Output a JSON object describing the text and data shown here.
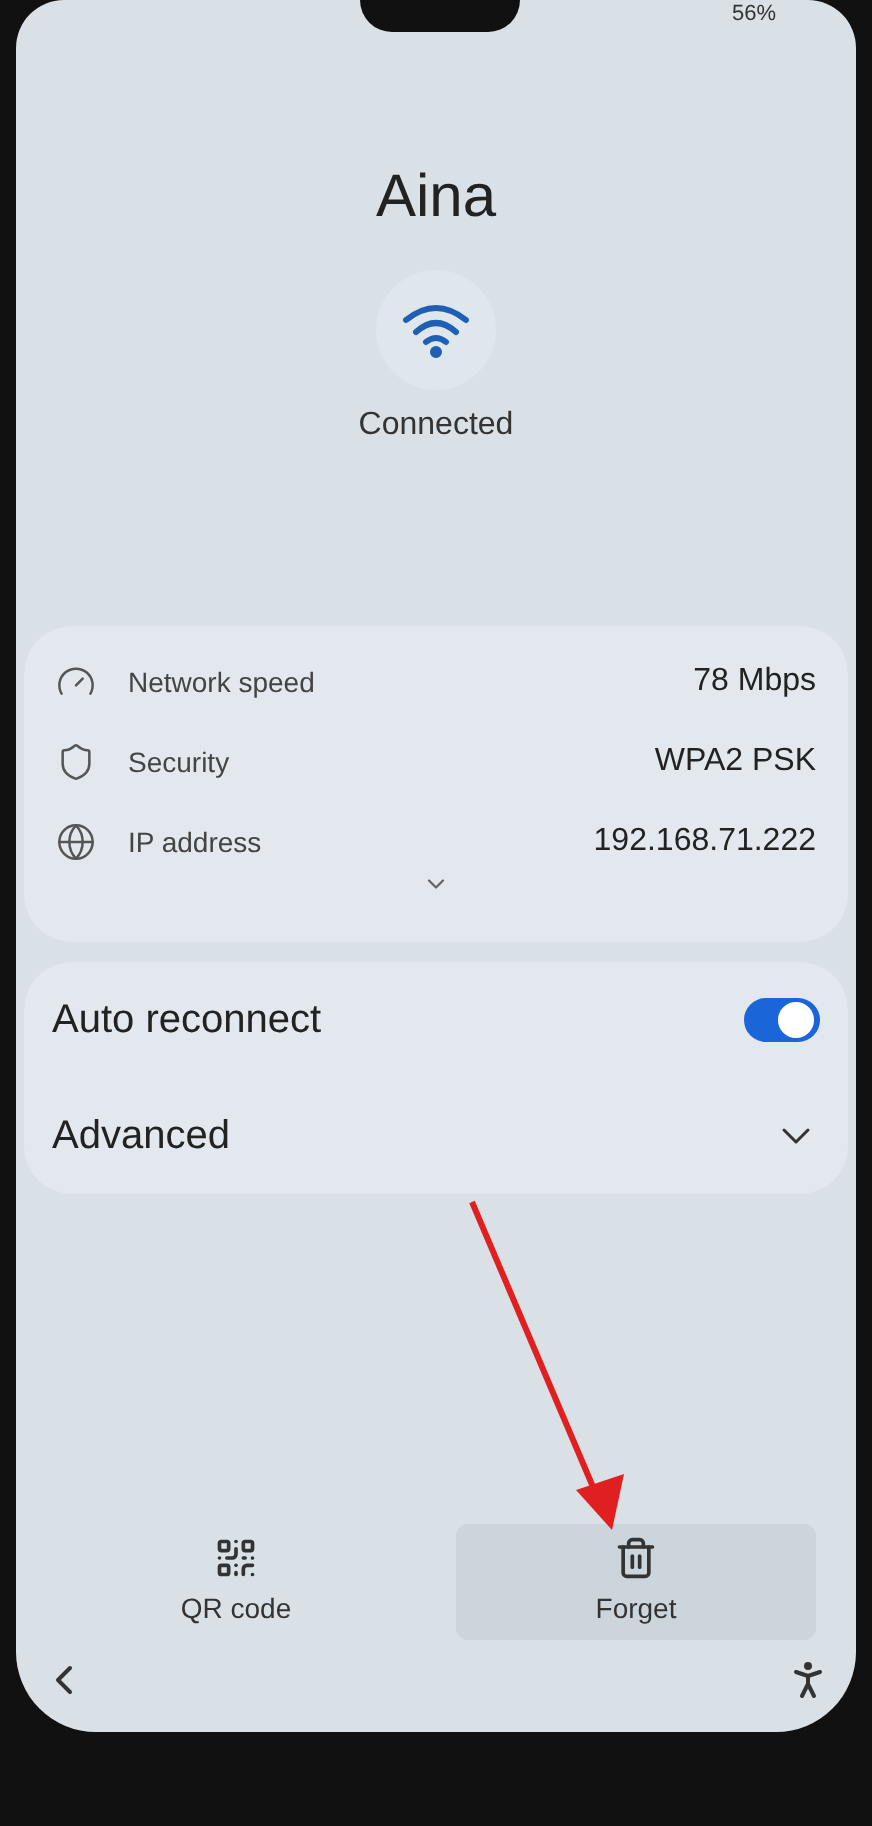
{
  "status_bar": {
    "battery": "56%"
  },
  "network": {
    "name": "Aina",
    "status": "Connected"
  },
  "details": [
    {
      "kind": "speed",
      "label": "Network speed",
      "value": "78 Mbps"
    },
    {
      "kind": "security",
      "label": "Security",
      "value": "WPA2 PSK"
    },
    {
      "kind": "ip",
      "label": "IP address",
      "value": "192.168.71.222"
    }
  ],
  "settings": [
    {
      "kind": "toggle",
      "label": "Auto reconnect",
      "on": true
    },
    {
      "kind": "expand",
      "label": "Advanced",
      "expanded": false
    }
  ],
  "actions": [
    {
      "kind": "qr",
      "label": "QR code",
      "pressed": false
    },
    {
      "kind": "trash",
      "label": "Forget",
      "pressed": true
    }
  ]
}
